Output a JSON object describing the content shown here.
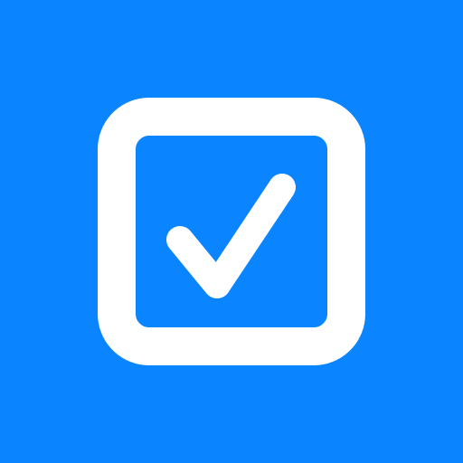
{
  "icon": {
    "name": "checkbox-checked-icon",
    "background_color": "#0A84FF",
    "foreground_color": "#FFFFFF"
  }
}
